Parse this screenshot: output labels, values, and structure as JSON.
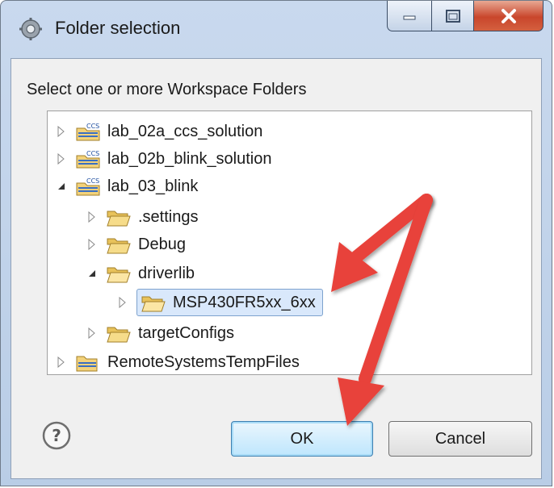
{
  "window": {
    "title": "Folder selection",
    "app_icon": "eclipse-gear-icon",
    "caption_buttons": [
      "minimize-icon",
      "maximize-icon",
      "close-icon"
    ]
  },
  "prompt": "Select one or more Workspace Folders",
  "tree": {
    "items": [
      {
        "label": "lab_02a_ccs_solution",
        "level": 0,
        "state": "collapsed",
        "icon": "ccs-project-icon"
      },
      {
        "label": "lab_02b_blink_solution",
        "level": 0,
        "state": "collapsed",
        "icon": "ccs-project-icon"
      },
      {
        "label": "lab_03_blink",
        "level": 0,
        "state": "expanded",
        "icon": "ccs-project-icon"
      },
      {
        "label": ".settings",
        "level": 1,
        "state": "collapsed",
        "icon": "folder-icon"
      },
      {
        "label": "Debug",
        "level": 1,
        "state": "collapsed",
        "icon": "folder-icon"
      },
      {
        "label": "driverlib",
        "level": 1,
        "state": "expanded",
        "icon": "folder-icon"
      },
      {
        "label": "MSP430FR5xx_6xx",
        "level": 2,
        "state": "collapsed",
        "icon": "folder-icon",
        "selected": true
      },
      {
        "label": "targetConfigs",
        "level": 1,
        "state": "collapsed",
        "icon": "folder-icon"
      },
      {
        "label": "RemoteSystemsTempFiles",
        "level": 0,
        "state": "collapsed",
        "icon": "project-icon"
      }
    ]
  },
  "buttons": {
    "ok": "OK",
    "cancel": "Cancel"
  },
  "colors": {
    "annotation_arrow": "#e8423a",
    "selection": "#d9e8fb",
    "folder": "#e8c25a"
  }
}
